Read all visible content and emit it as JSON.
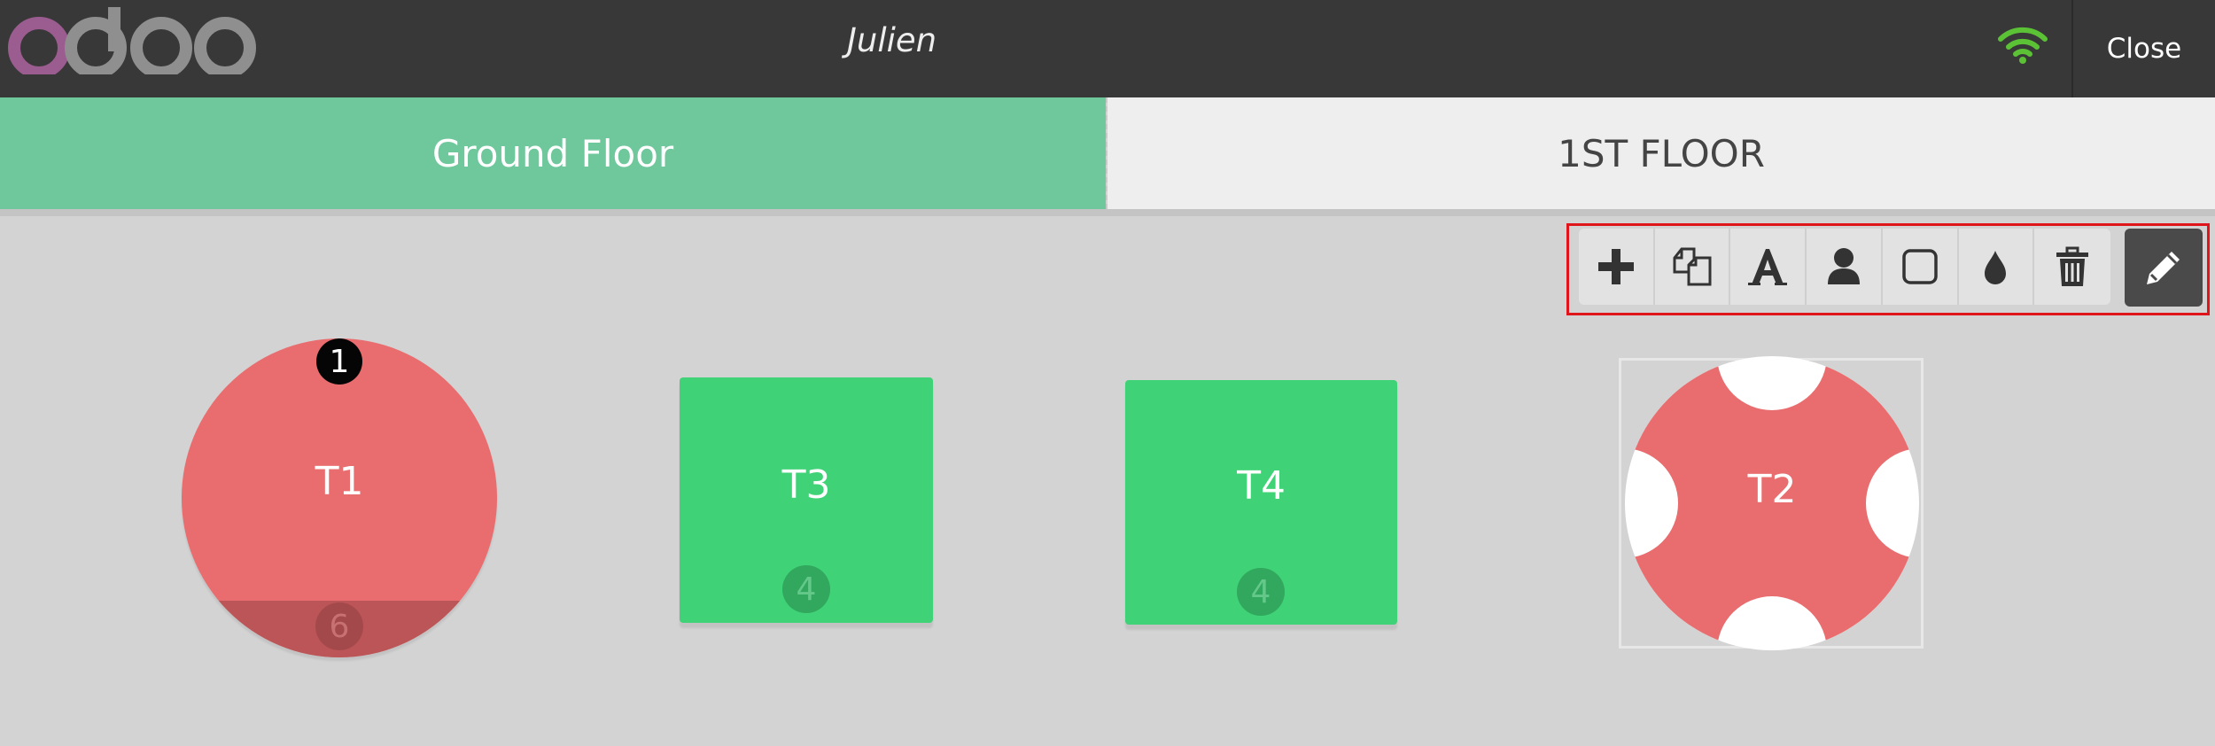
{
  "header": {
    "logo_text": "odoo",
    "username": "Julien",
    "close_label": "Close"
  },
  "floors": [
    {
      "label": "Ground Floor",
      "active": true
    },
    {
      "label": "1ST FLOOR",
      "active": false
    }
  ],
  "toolbar": {
    "tools": [
      "plus-icon",
      "duplicate-icon",
      "rename-icon",
      "seats-icon",
      "shape-icon",
      "color-icon",
      "trash-icon"
    ],
    "edit_icon": "pencil-icon"
  },
  "tables": [
    {
      "name": "T1",
      "shape": "round",
      "seats": "6",
      "badge": "1",
      "color": "#e96c6e"
    },
    {
      "name": "T3",
      "shape": "square",
      "seats": "4",
      "color": "#3fd276"
    },
    {
      "name": "T4",
      "shape": "square",
      "seats": "4",
      "color": "#3fd276"
    },
    {
      "name": "T2",
      "shape": "round",
      "selected": true,
      "color": "#e96c6e"
    }
  ],
  "colors": {
    "topbar": "#383838",
    "active_tab": "#6fc79c",
    "inactive_tab": "#efeeef",
    "floor": "#d3d3d3",
    "occupied": "#e96c6e",
    "available": "#3fd276",
    "wifi": "#5bc236",
    "highlight": "#e0151b"
  }
}
